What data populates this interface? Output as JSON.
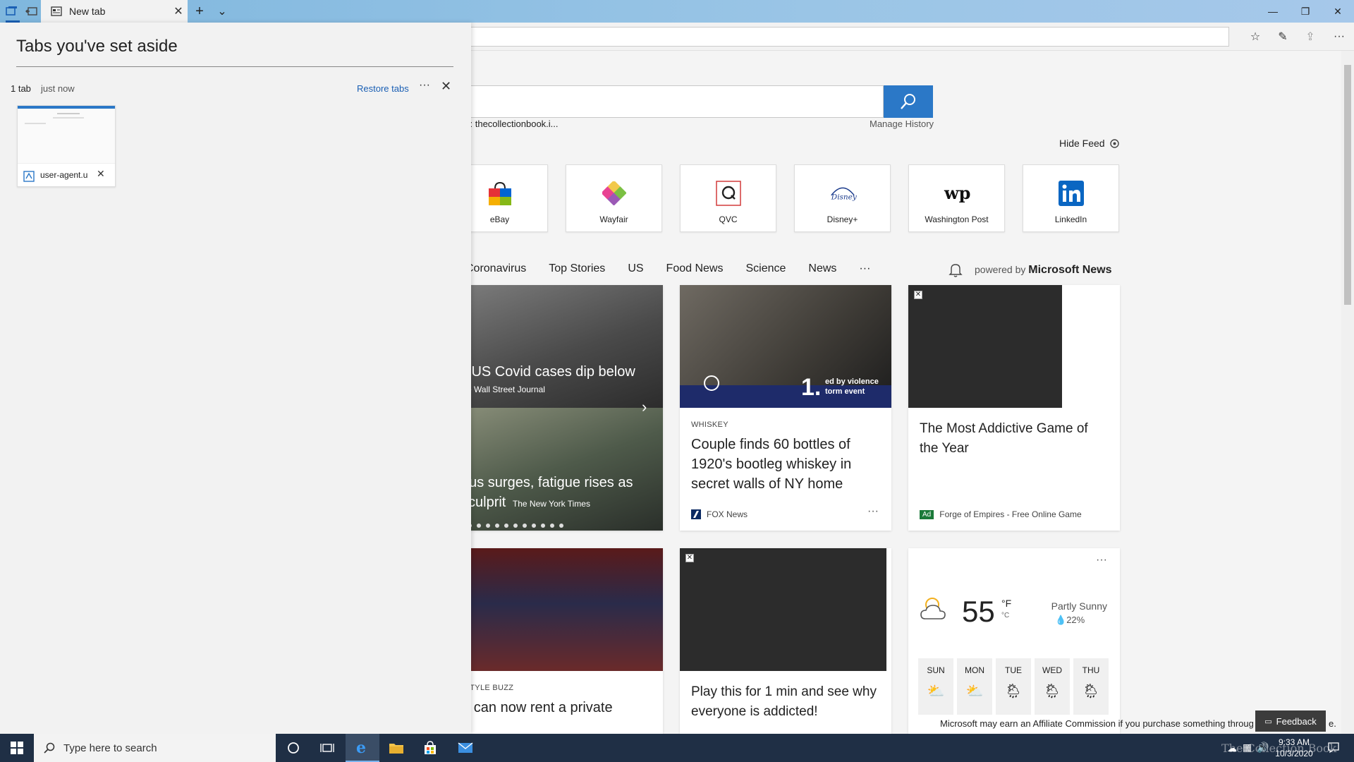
{
  "titlebar": {
    "tab_title": "New tab",
    "tab_close": "✕",
    "new_tab": "+",
    "tab_list": "⌄",
    "minimize": "—",
    "restore": "❐",
    "close": "✕"
  },
  "toolbar": {
    "favorites": "☆",
    "notes": "✎",
    "share": "⇪",
    "more": "···"
  },
  "aside": {
    "title": "Tabs you've set aside",
    "tab_count": "1 tab",
    "time": "just now",
    "restore_label": "Restore tabs",
    "more": "···",
    "close": "✕",
    "thumbnail": {
      "label": "user-agent.u",
      "close": "✕"
    }
  },
  "page": {
    "recent_sites": "s:  thecollectionbook.i...",
    "manage_history": "Manage History",
    "hide_feed": "Hide Feed",
    "top_sites": [
      {
        "label": "eBay",
        "icon": "ebay-icon"
      },
      {
        "label": "Wayfair",
        "icon": "wayfair-icon"
      },
      {
        "label": "QVC",
        "icon": "qvc-icon"
      },
      {
        "label": "Disney+",
        "icon": "disney-icon"
      },
      {
        "label": "Washington Post",
        "icon": "washington-post-icon"
      },
      {
        "label": "LinkedIn",
        "icon": "linkedin-icon"
      }
    ],
    "feed_tabs": [
      "Coronavirus",
      "Top Stories",
      "US",
      "Food News",
      "Science",
      "News",
      "···"
    ],
    "powered_by_prefix": "powered by",
    "powered_by_brand": "Microsoft News",
    "carousel": [
      {
        "caption": "ily US Covid cases dip below",
        "source": "The Wall Street Journal"
      },
      {
        "caption": "virus surges, fatigue rises as",
        "caption2": "w culprit",
        "source": "The New York Times"
      }
    ],
    "card_whiskey": {
      "category": "WHISKEY",
      "title": "Couple finds 60 bottles of 1920's bootleg whiskey in secret walls of NY home",
      "source": "FOX News",
      "more": "···",
      "image_caption": "1.",
      "image_caption_sub": "ed by violence\ntorm event"
    },
    "card_ad": {
      "title": "The Most Addictive Game of the Year",
      "ad_badge": "Ad",
      "source": "Forge of Empires - Free Online Game"
    },
    "card_lifestyle": {
      "category": "FESTYLE BUZZ",
      "title": "ou can now rent a private"
    },
    "card_play": {
      "title": "Play this for 1 min and see why everyone is addicted!"
    },
    "weather": {
      "temp": "55",
      "unit_f": "°F",
      "unit_c": "°C",
      "condition": "Partly Sunny",
      "precip": "22%",
      "more": "···",
      "days": [
        "SUN",
        "MON",
        "TUE",
        "WED",
        "THU"
      ]
    },
    "affiliate": "Microsoft may earn an Affiliate Commission if you purchase something throug",
    "affiliate_tail": "e.",
    "feedback": "Feedback"
  },
  "taskbar": {
    "search_placeholder": "Type here to search",
    "time": "9:33 AM",
    "date": "10/3/2020",
    "watermark": "The Collection Book"
  },
  "colors": {
    "accent": "#2b78c7",
    "titlebar": "#9ac5e6",
    "taskbar": "#1f2f45"
  }
}
